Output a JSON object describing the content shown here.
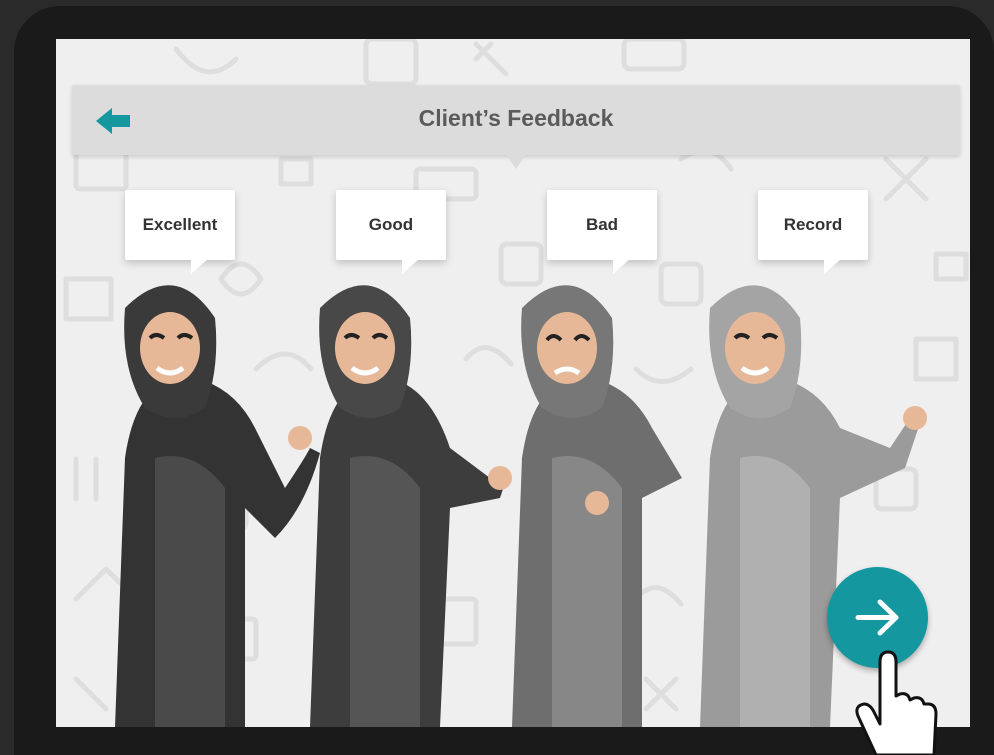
{
  "header": {
    "title": "Client’s Feedback"
  },
  "options": [
    {
      "label": "Excellent"
    },
    {
      "label": "Good"
    },
    {
      "label": "Bad"
    },
    {
      "label": "Record"
    }
  ],
  "colors": {
    "accent": "#14979f",
    "header_bg": "#dcdcdc",
    "screen_bg": "#efefef"
  },
  "icons": {
    "back": "arrow-left-icon",
    "next": "arrow-right-icon",
    "pointer": "pointing-hand-icon"
  }
}
